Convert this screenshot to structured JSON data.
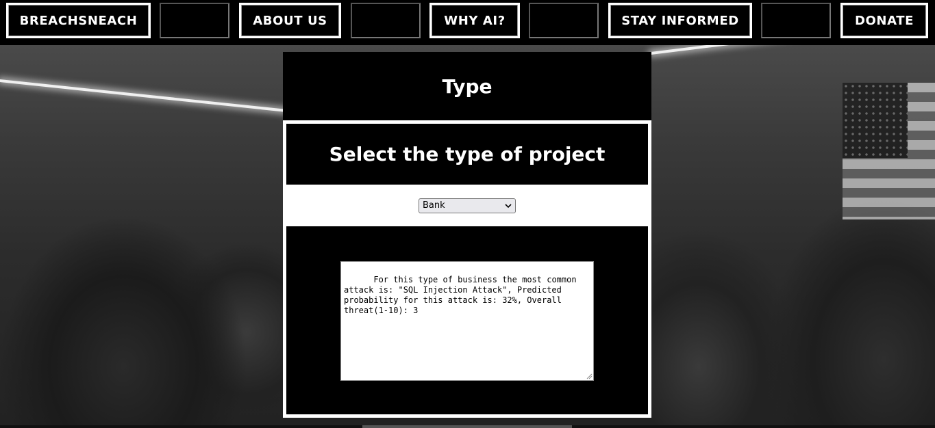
{
  "nav": {
    "brand": "BREACHSNEACH",
    "about": "ABOUT US",
    "why_ai": "WHY AI?",
    "stay_informed": "STAY INFORMED",
    "donate": "DONATE"
  },
  "panel": {
    "title": "Type",
    "subtitle": "Select the type of project",
    "select": {
      "selected": "Bank"
    },
    "result_text": "For this type of business the most common attack is: \"SQL Injection Attack\", Predicted probability for this attack is: 32%, Overall threat(1-10): 3"
  },
  "colors": {
    "background": "#000000",
    "text": "#ffffff",
    "panel": "#ffffff",
    "select_bg": "#e9e9ed"
  }
}
